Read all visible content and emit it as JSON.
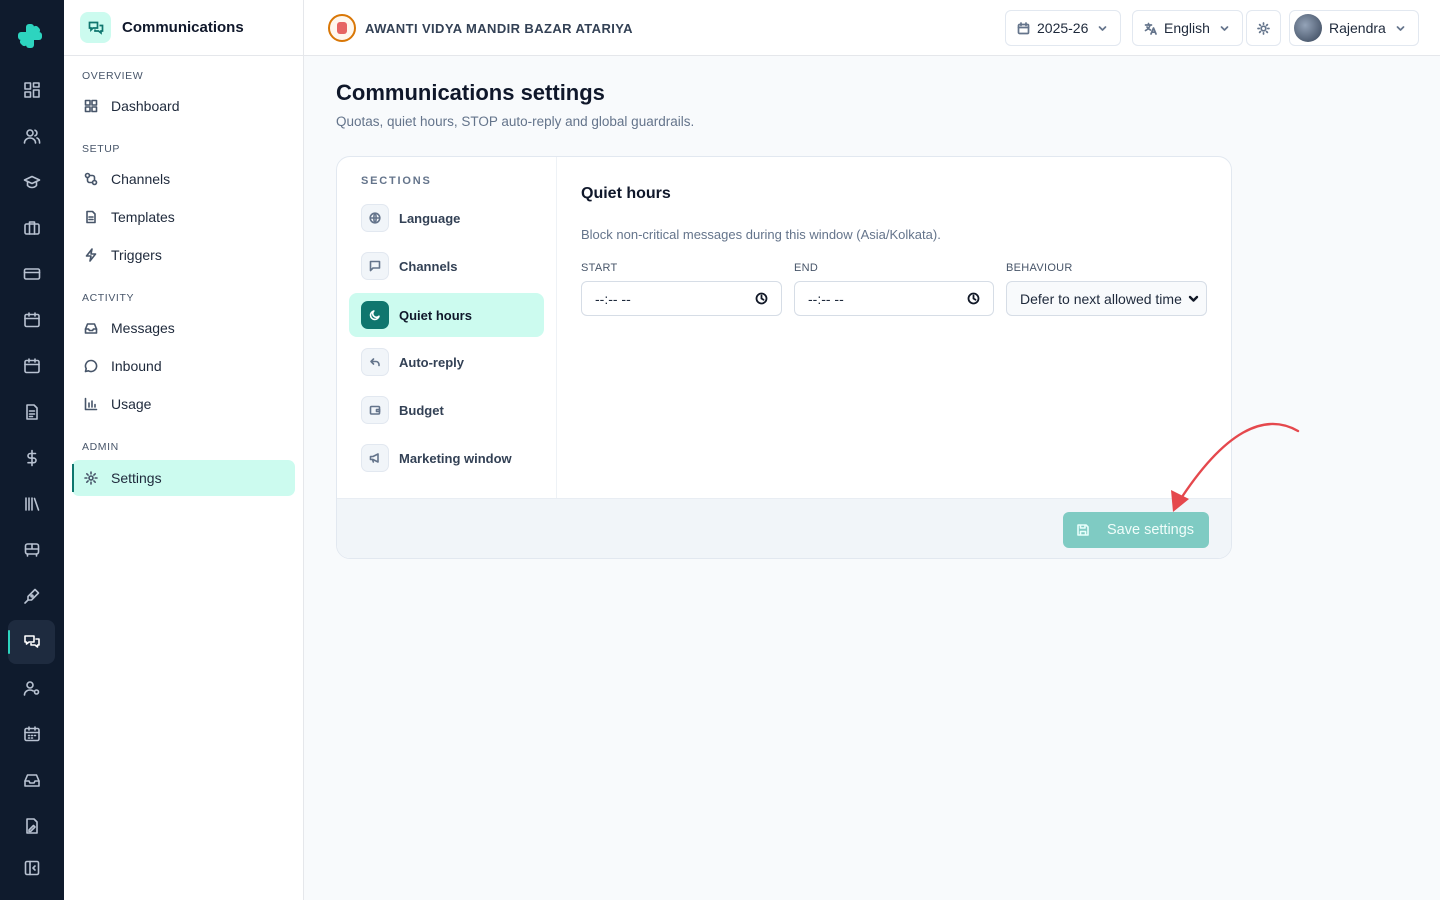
{
  "module": {
    "title": "Communications"
  },
  "sidebar": {
    "groups": {
      "overview": "OVERVIEW",
      "setup": "SETUP",
      "activity": "ACTIVITY",
      "admin": "ADMIN"
    },
    "items": {
      "dashboard": "Dashboard",
      "channels": "Channels",
      "templates": "Templates",
      "triggers": "Triggers",
      "messages": "Messages",
      "inbound": "Inbound",
      "usage": "Usage",
      "settings": "Settings"
    },
    "active": "settings"
  },
  "topbar": {
    "school_name": "AWANTI VIDYA MANDIR BAZAR ATARIYA",
    "year": "2025-26",
    "language": "English",
    "user": "Rajendra"
  },
  "page": {
    "title": "Communications settings",
    "subtitle": "Quotas, quiet hours, STOP auto-reply and global guardrails."
  },
  "sections": {
    "heading": "SECTIONS",
    "items": {
      "language": "Language",
      "channels": "Channels",
      "quiet_hours": "Quiet hours",
      "auto_reply": "Auto-reply",
      "budget": "Budget",
      "marketing_window": "Marketing window"
    },
    "active": "quiet_hours"
  },
  "panel": {
    "title": "Quiet hours",
    "description": "Block non-critical messages during this window (Asia/Kolkata).",
    "start_label": "START",
    "start_value": "--:-- --",
    "end_label": "END",
    "end_value": "--:-- --",
    "behaviour_label": "BEHAVIOUR",
    "behaviour_value": "Defer to next allowed time"
  },
  "footer": {
    "save_label": "Save settings"
  },
  "colors": {
    "rail_bg": "#0f1b2d",
    "accent": "#0f766e",
    "accent_light": "#ccfbef",
    "save_disabled": "#7fcbc3",
    "annotation_arrow": "#e5484d"
  }
}
